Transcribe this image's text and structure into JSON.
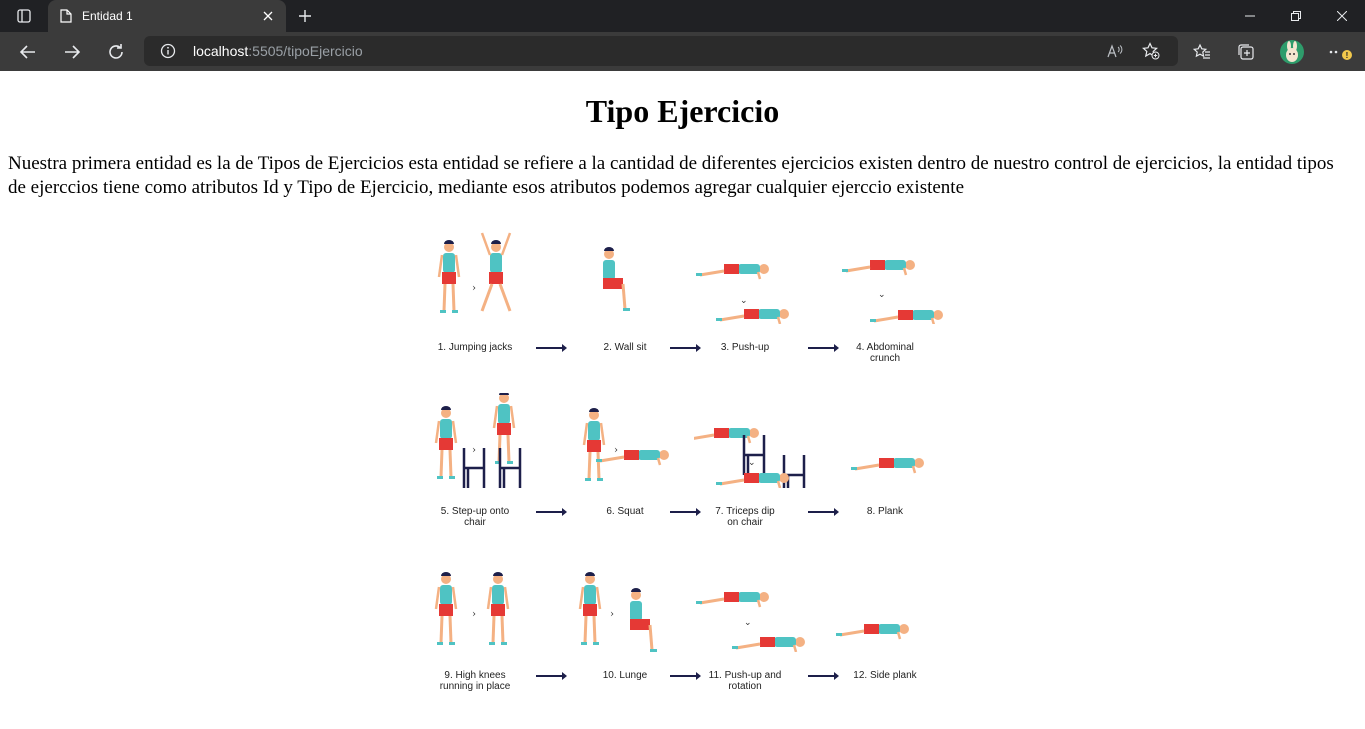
{
  "browser": {
    "tab_title": "Entidad 1",
    "url_host": "localhost",
    "url_rest": ":5505/tipoEjercicio",
    "menu_badge": "!"
  },
  "page": {
    "title": "Tipo Ejercicio",
    "description": "Nuestra primera entidad es la de Tipos de Ejercicios esta entidad se refiere a la cantidad de diferentes ejercicios existen dentro de nuestro control de ejercicios, la entidad tipos de ejerccios tiene como atributos Id y Tipo de Ejercicio, mediante esos atributos podemos agregar cualquier ejerccio existente"
  },
  "figure": {
    "exercises": [
      {
        "line1": "1. Jumping jacks",
        "line2": ""
      },
      {
        "line1": "2. Wall sit",
        "line2": ""
      },
      {
        "line1": "3. Push-up",
        "line2": ""
      },
      {
        "line1": "4. Abdominal",
        "line2": "crunch"
      },
      {
        "line1": "5. Step-up onto",
        "line2": "chair"
      },
      {
        "line1": "6. Squat",
        "line2": ""
      },
      {
        "line1": "7. Triceps dip",
        "line2": "on chair"
      },
      {
        "line1": "8. Plank",
        "line2": ""
      },
      {
        "line1": "9. High knees",
        "line2": "running in place"
      },
      {
        "line1": "10. Lunge",
        "line2": ""
      },
      {
        "line1": "11. Push-up and",
        "line2": "rotation"
      },
      {
        "line1": "12. Side plank",
        "line2": ""
      }
    ],
    "colors": {
      "shirt": "#4fc3c3",
      "shorts": "#e53935",
      "skin": "#f4b183",
      "hair": "#1d1f4a",
      "chair": "#1d1f4a"
    }
  }
}
